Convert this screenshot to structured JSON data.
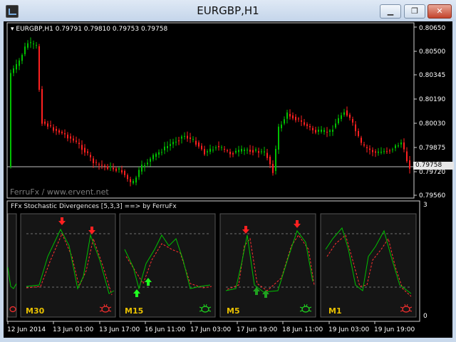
{
  "window": {
    "title": "EURGBP,H1",
    "minimize_icon": "minimize-icon",
    "restore_icon": "restore-icon",
    "close_icon": "close-icon",
    "minimize_glyph": "▁",
    "restore_glyph": "❐",
    "close_glyph": "✕"
  },
  "main_chart": {
    "symbol_line": "EURGBP,H1  0.79791 0.79810 0.79753 0.79758",
    "watermark": "FerruFx / www.ervent.net",
    "current_price_label": "0.79758",
    "price_ticks": [
      "0.80650",
      "0.80500",
      "0.80345",
      "0.80190",
      "0.80030",
      "0.79875",
      "0.79720",
      "0.79560"
    ],
    "colors": {
      "bull": "#00c000",
      "bear": "#ff2020",
      "price_line": "#c0c0c0"
    }
  },
  "indicator": {
    "title": "FFx Stochastic Divergences [5,3,3] ==> by FerruFx",
    "scale_top": "3",
    "scale_bottom": "0",
    "panels": [
      {
        "timeframe": "M30",
        "bug_icon": "bug-icon-red"
      },
      {
        "timeframe": "M15",
        "bug_icon": "bug-icon-green"
      },
      {
        "timeframe": "M5",
        "bug_icon": "bug-icon-green"
      },
      {
        "timeframe": "M1",
        "bug_icon": "bug-icon-red"
      }
    ]
  },
  "time_axis": [
    "12 Jun 2014",
    "13 Jun 01:00",
    "13 Jun 17:00",
    "16 Jun 11:00",
    "17 Jun 03:00",
    "17 Jun 19:00",
    "18 Jun 11:00",
    "19 Jun 03:00",
    "19 Jun 19:00"
  ],
  "colors": {
    "timeframe_label": "#e8c000",
    "stoch_main": "#00c000",
    "stoch_signal": "#ff3030",
    "level_line": "#707070"
  }
}
